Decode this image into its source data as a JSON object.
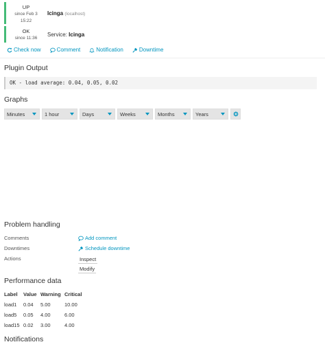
{
  "host_state": {
    "label": "UP",
    "since_line1": "since Feb 3",
    "since_line2": "15:22",
    "name": "Icinga",
    "address": "(localhost)"
  },
  "service_state": {
    "label": "OK",
    "since": "since 11:36",
    "prefix": "Service:",
    "name": "Icinga"
  },
  "state_color": "#44bb77",
  "link_color": "#0095bf",
  "actions": {
    "check_now": "Check now",
    "comment": "Comment",
    "notification": "Notification",
    "downtime": "Downtime"
  },
  "plugin_output": {
    "title": "Plugin Output",
    "text": "OK - load average: 0.04, 0.05, 0.02"
  },
  "graphs": {
    "title": "Graphs",
    "selects": [
      "Minutes",
      "1 hour",
      "Days",
      "Weeks",
      "Months",
      "Years"
    ]
  },
  "problem_handling": {
    "title": "Problem handling",
    "comments_label": "Comments",
    "add_comment": "Add comment",
    "downtimes_label": "Downtimes",
    "schedule_downtime": "Schedule downtime",
    "actions_label": "Actions",
    "inspect": "Inspect",
    "modify": "Modify"
  },
  "performance": {
    "title": "Performance data",
    "headers": [
      "Label",
      "Value",
      "Warning",
      "Critical"
    ],
    "rows": [
      [
        "load1",
        "0.04",
        "5.00",
        "10.00"
      ],
      [
        "load5",
        "0.05",
        "4.00",
        "6.00"
      ],
      [
        "load15",
        "0.02",
        "3.00",
        "4.00"
      ]
    ]
  },
  "notifications": {
    "title": "Notifications"
  }
}
